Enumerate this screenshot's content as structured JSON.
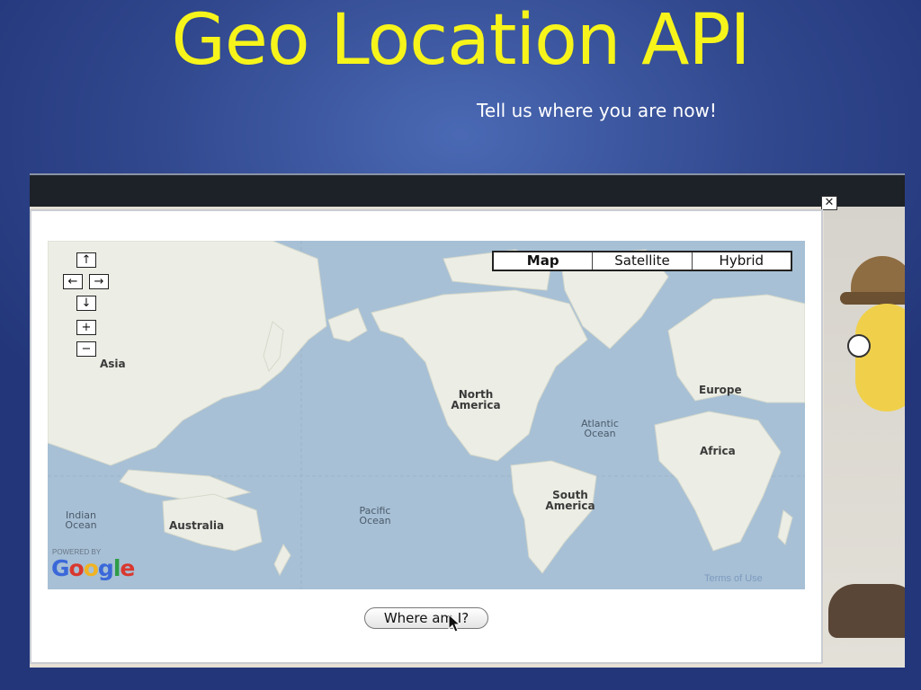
{
  "slide": {
    "title": "Geo Location API",
    "subtitle": "Tell us where you are now!"
  },
  "window": {
    "close_icon": "✕"
  },
  "map": {
    "type_controls": [
      "Map",
      "Satellite",
      "Hybrid"
    ],
    "selected_type": "Map",
    "nav_controls": {
      "pan_up": "↑",
      "pan_left": "←",
      "pan_right": "→",
      "pan_down": "↓",
      "zoom_in": "+",
      "zoom_out": "−"
    },
    "continent_labels": {
      "asia": "Asia",
      "north_america": "North America",
      "europe": "Europe",
      "africa": "Africa",
      "south_america": "South America",
      "australia": "Australia"
    },
    "ocean_labels": {
      "atlantic": "Atlantic Ocean",
      "indian": "Indian Ocean",
      "pacific": "Pacific Ocean"
    },
    "attribution": {
      "powered_by": "POWERED BY",
      "logo": "Google",
      "terms": "Terms of Use"
    },
    "colors": {
      "water": "#a7c0d5",
      "land": "#eceee5"
    }
  },
  "action_button": "Where am I?",
  "colors": {
    "title": "#f6f41a",
    "background": "#31488e"
  }
}
